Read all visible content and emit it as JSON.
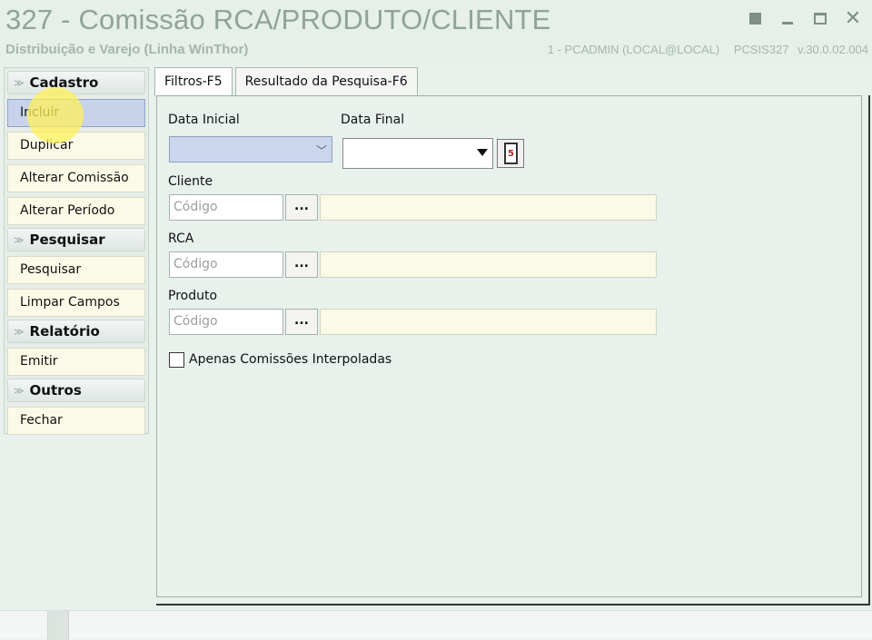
{
  "window": {
    "title": "327 - Comissão RCA/PRODUTO/CLIENTE",
    "subtitle": "Distribuição e Varejo (Linha WinThor)",
    "user": "1 - PCADMIN (LOCAL@LOCAL)",
    "program": "PCSIS327",
    "version": "v.30.0.02.004"
  },
  "sidebar": {
    "groups": [
      {
        "title": "Cadastro",
        "items": [
          "Incluir",
          "Duplicar",
          "Alterar Comissão",
          "Alterar Período"
        ]
      },
      {
        "title": "Pesquisar",
        "items": [
          "Pesquisar",
          "Limpar Campos"
        ]
      },
      {
        "title": "Relatório",
        "items": [
          "Emitir"
        ]
      },
      {
        "title": "Outros",
        "items": [
          "Fechar"
        ]
      }
    ],
    "active_item": "Incluir"
  },
  "tabs": [
    {
      "label": "Filtros-F5",
      "active": true
    },
    {
      "label": "Resultado da Pesquisa-F6",
      "active": false
    }
  ],
  "filters": {
    "data_inicial_label": "Data Inicial",
    "data_final_label": "Data Final",
    "data_inicial_value": "",
    "data_final_value": "",
    "cliente_label": "Cliente",
    "rca_label": "RCA",
    "produto_label": "Produto",
    "code_placeholder": "Código",
    "ellipsis": "...",
    "checkbox_label": "Apenas Comissões Interpoladas",
    "checkbox_checked": false
  }
}
